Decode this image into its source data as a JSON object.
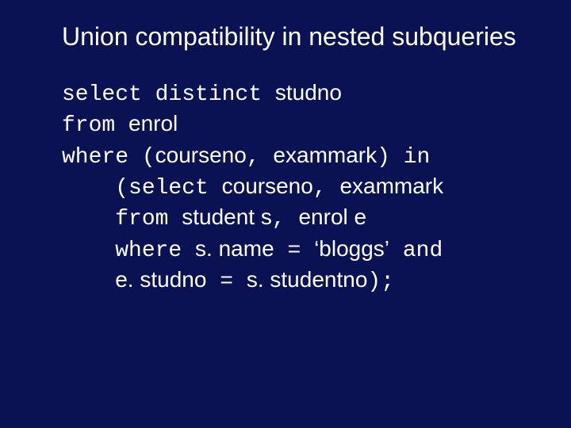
{
  "title": "Union compatibility in nested subqueries",
  "sql": {
    "l1": {
      "kw1": "select distinct ",
      "id1": "studno"
    },
    "l2": {
      "kw1": "from ",
      "id1": "enrol"
    },
    "l3": {
      "kw1": "where (",
      "id1": "courseno",
      "sep1": ", ",
      "id2": "exammark",
      "kw2": ") in"
    },
    "l4": {
      "indent": "    ",
      "kw1": "(select ",
      "id1": "courseno",
      "sep1": ", ",
      "id2": "exammark"
    },
    "l5": {
      "indent": "    ",
      "kw1": "from ",
      "id1": "student s",
      "sep1": ", ",
      "id2": "enrol e"
    },
    "l6": {
      "indent": "    ",
      "kw1": "where ",
      "id1": "s. name",
      "op1": " = ",
      "lit1": "‘bloggs’",
      "kw2": " and"
    },
    "l7": {
      "indent": "    ",
      "id1": "e. studno",
      "op1": " = ",
      "id2": "s. studentno",
      "tail": ");"
    }
  }
}
